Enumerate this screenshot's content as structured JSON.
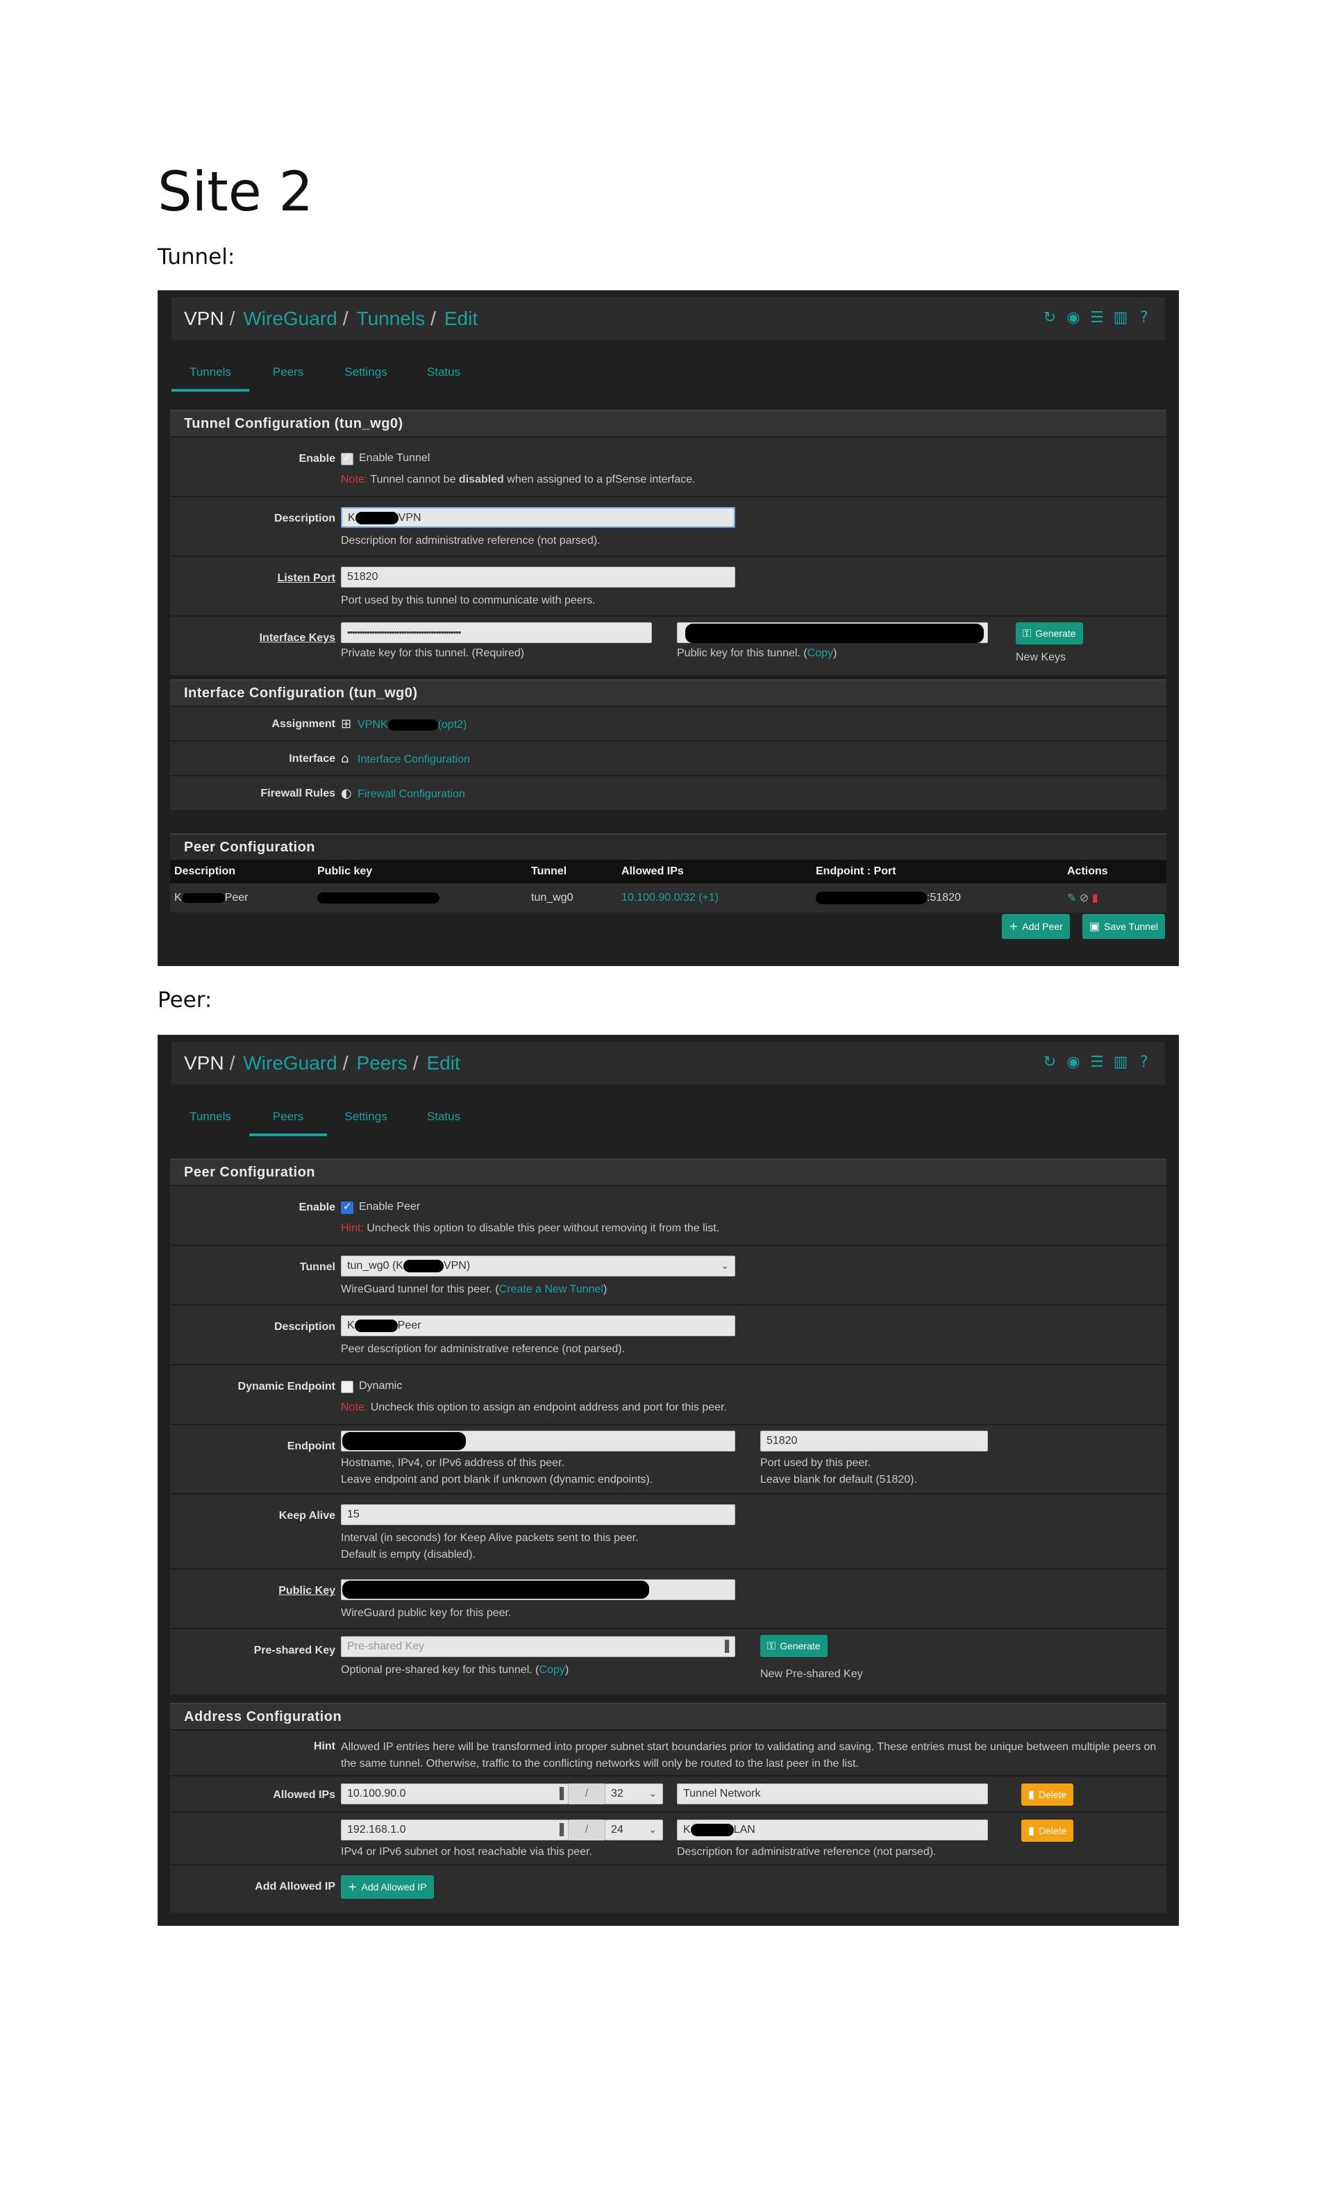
{
  "doc": {
    "title": "Site 2",
    "tunnel_label": "Tunnel:",
    "peer_label": "Peer:"
  },
  "tunnel_page": {
    "breadcrumb": [
      "VPN",
      "WireGuard",
      "Tunnels",
      "Edit"
    ],
    "header_icons": [
      "refresh-icon",
      "record-icon",
      "sliders-icon",
      "chart-icon",
      "help-icon"
    ],
    "tabs": [
      "Tunnels",
      "Peers",
      "Settings",
      "Status"
    ],
    "active_tab": "Tunnels",
    "tunnel_section": "Tunnel Configuration (tun_wg0)",
    "enable": {
      "label": "Enable",
      "checkbox": "Enable Tunnel",
      "note_prefix": "Note:",
      "note_pre": "Tunnel cannot be",
      "note_bold": "disabled",
      "note_post": "when assigned to a pfSense interface."
    },
    "description": {
      "label": "Description",
      "value_start": "K",
      "value_end": "VPN",
      "help": "Description for administrative reference (not parsed)."
    },
    "listen_port": {
      "label": "Listen Port",
      "value": "51820",
      "help": "Port used by this tunnel to communicate with peers."
    },
    "interface_keys": {
      "label": "Interface Keys",
      "private_value": "••••••••••••••••••••••••••••••••••••••••••••••",
      "private_help": "Private key for this tunnel. (Required)",
      "public_help": "Public key for this tunnel. (",
      "copy": "Copy",
      "close_paren": ")",
      "generate": "Generate",
      "generate_help": "New Keys"
    },
    "interface_section": "Interface Configuration (tun_wg0)",
    "assignment": {
      "label": "Assignment",
      "link_start": "VPNK",
      "link_end": "(opt2)"
    },
    "interface": {
      "label": "Interface",
      "link": "Interface Configuration"
    },
    "firewall": {
      "label": "Firewall Rules",
      "link": "Firewall Configuration"
    },
    "peer_section": "Peer Configuration",
    "peer_table": {
      "headers": [
        "Description",
        "Public key",
        "Tunnel",
        "Allowed IPs",
        "Endpoint : Port",
        "Actions"
      ],
      "row": {
        "desc_start": "K",
        "desc_end": "Peer",
        "tunnel": "tun_wg0",
        "allowed": "10.100.90.0/32 (+1)",
        "port": ":51820"
      }
    },
    "add_peer": "Add Peer",
    "save_tunnel": "Save Tunnel"
  },
  "peer_page": {
    "breadcrumb": [
      "VPN",
      "WireGuard",
      "Peers",
      "Edit"
    ],
    "tabs": [
      "Tunnels",
      "Peers",
      "Settings",
      "Status"
    ],
    "active_tab": "Peers",
    "peer_section": "Peer Configuration",
    "enable": {
      "label": "Enable",
      "checkbox": "Enable Peer",
      "note_prefix": "Hint:",
      "note": "Uncheck this option to disable this peer without removing it from the list."
    },
    "tunnel": {
      "label": "Tunnel",
      "value_start": "tun_wg0 (K",
      "value_end": "VPN)",
      "help_pre": "WireGuard tunnel for this peer. (",
      "help_link": "Create a New Tunnel",
      "help_post": ")"
    },
    "description": {
      "label": "Description",
      "value_start": "K",
      "value_end": "Peer",
      "help": "Peer description for administrative reference (not parsed)."
    },
    "dynamic": {
      "label": "Dynamic Endpoint",
      "checkbox": "Dynamic",
      "note_prefix": "Note:",
      "note": "Uncheck this option to assign an endpoint address and port for this peer."
    },
    "endpoint": {
      "label": "Endpoint",
      "help1": "Hostname, IPv4, or IPv6 address of this peer.",
      "help2": "Leave endpoint and port blank if unknown (dynamic endpoints).",
      "port_value": "51820",
      "port_help1": "Port used by this peer.",
      "port_help2": "Leave blank for default (51820)."
    },
    "keep_alive": {
      "label": "Keep Alive",
      "value": "15",
      "help1": "Interval (in seconds) for Keep Alive packets sent to this peer.",
      "help2": "Default is empty (disabled)."
    },
    "public_key": {
      "label": "Public Key",
      "help": "WireGuard public key for this peer."
    },
    "psk": {
      "label": "Pre-shared Key",
      "placeholder": "Pre-shared Key",
      "help_pre": "Optional pre-shared key for this tunnel. (",
      "copy": "Copy",
      "help_post": ")",
      "generate": "Generate",
      "generate_help": "New Pre-shared Key"
    },
    "address_section": "Address Configuration",
    "hint": {
      "label": "Hint",
      "text": "Allowed IP entries here will be transformed into proper subnet start boundaries prior to validating and saving. These entries must be unique between multiple peers on the same tunnel. Otherwise, traffic to the conflicting networks will only be routed to the last peer in the list."
    },
    "allowed_ips": {
      "label": "Allowed IPs",
      "rows": [
        {
          "ip": "10.100.90.0",
          "mask": "32",
          "desc": "Tunnel Network",
          "desc_start": "",
          "desc_end": ""
        },
        {
          "ip": "192.168.1.0",
          "mask": "24",
          "desc": "",
          "desc_start": "K",
          "desc_end": "LAN"
        }
      ],
      "slash": "/",
      "help_ip": "IPv4 or IPv6 subnet or host reachable via this peer.",
      "help_desc": "Description for administrative reference (not parsed).",
      "delete": "Delete"
    },
    "add_allowed": {
      "label": "Add Allowed IP",
      "button": "Add Allowed IP"
    }
  },
  "colors": {
    "accent": "#17a2a0",
    "button_teal": "#16967f",
    "button_orange": "#f5a114",
    "note_red": "#d8323c"
  }
}
